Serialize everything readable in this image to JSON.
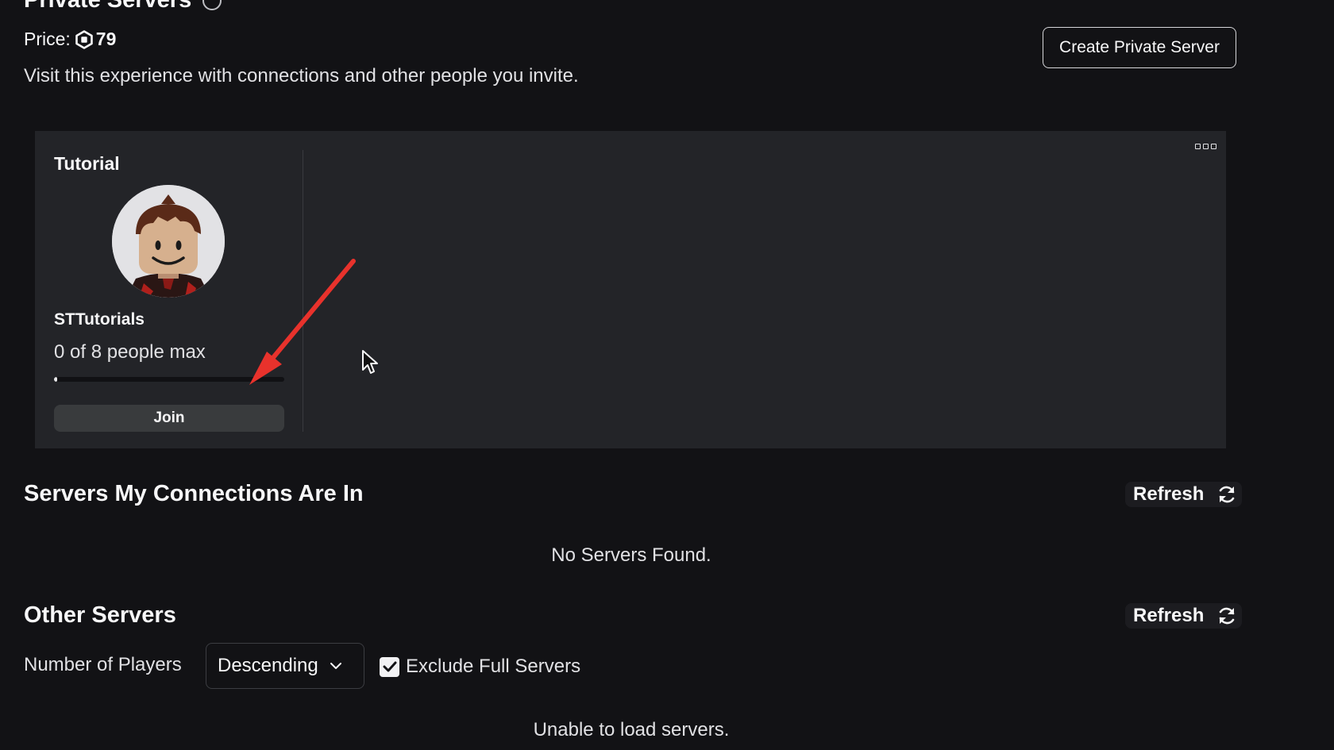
{
  "private_servers": {
    "title": "Private Servers",
    "price_label": "Price:",
    "price_value": "79",
    "description": "Visit this experience with connections and other people you invite.",
    "create_button": "Create Private Server"
  },
  "server_card": {
    "name": "Tutorial",
    "owner": "STTutorials",
    "capacity_text": "0 of 8 people max",
    "fill_fraction": 0,
    "join_label": "Join"
  },
  "connections": {
    "title": "Servers My Connections Are In",
    "refresh_label": "Refresh",
    "empty_message": "No Servers Found."
  },
  "other_servers": {
    "title": "Other Servers",
    "refresh_label": "Refresh",
    "filter_label": "Number of Players",
    "sort_value": "Descending",
    "exclude_full_label": "Exclude Full Servers",
    "exclude_full_checked": true,
    "status_message": "Unable to load servers."
  },
  "colors": {
    "background": "#121215",
    "panel": "#232428",
    "annotation_arrow": "#e8322c"
  }
}
